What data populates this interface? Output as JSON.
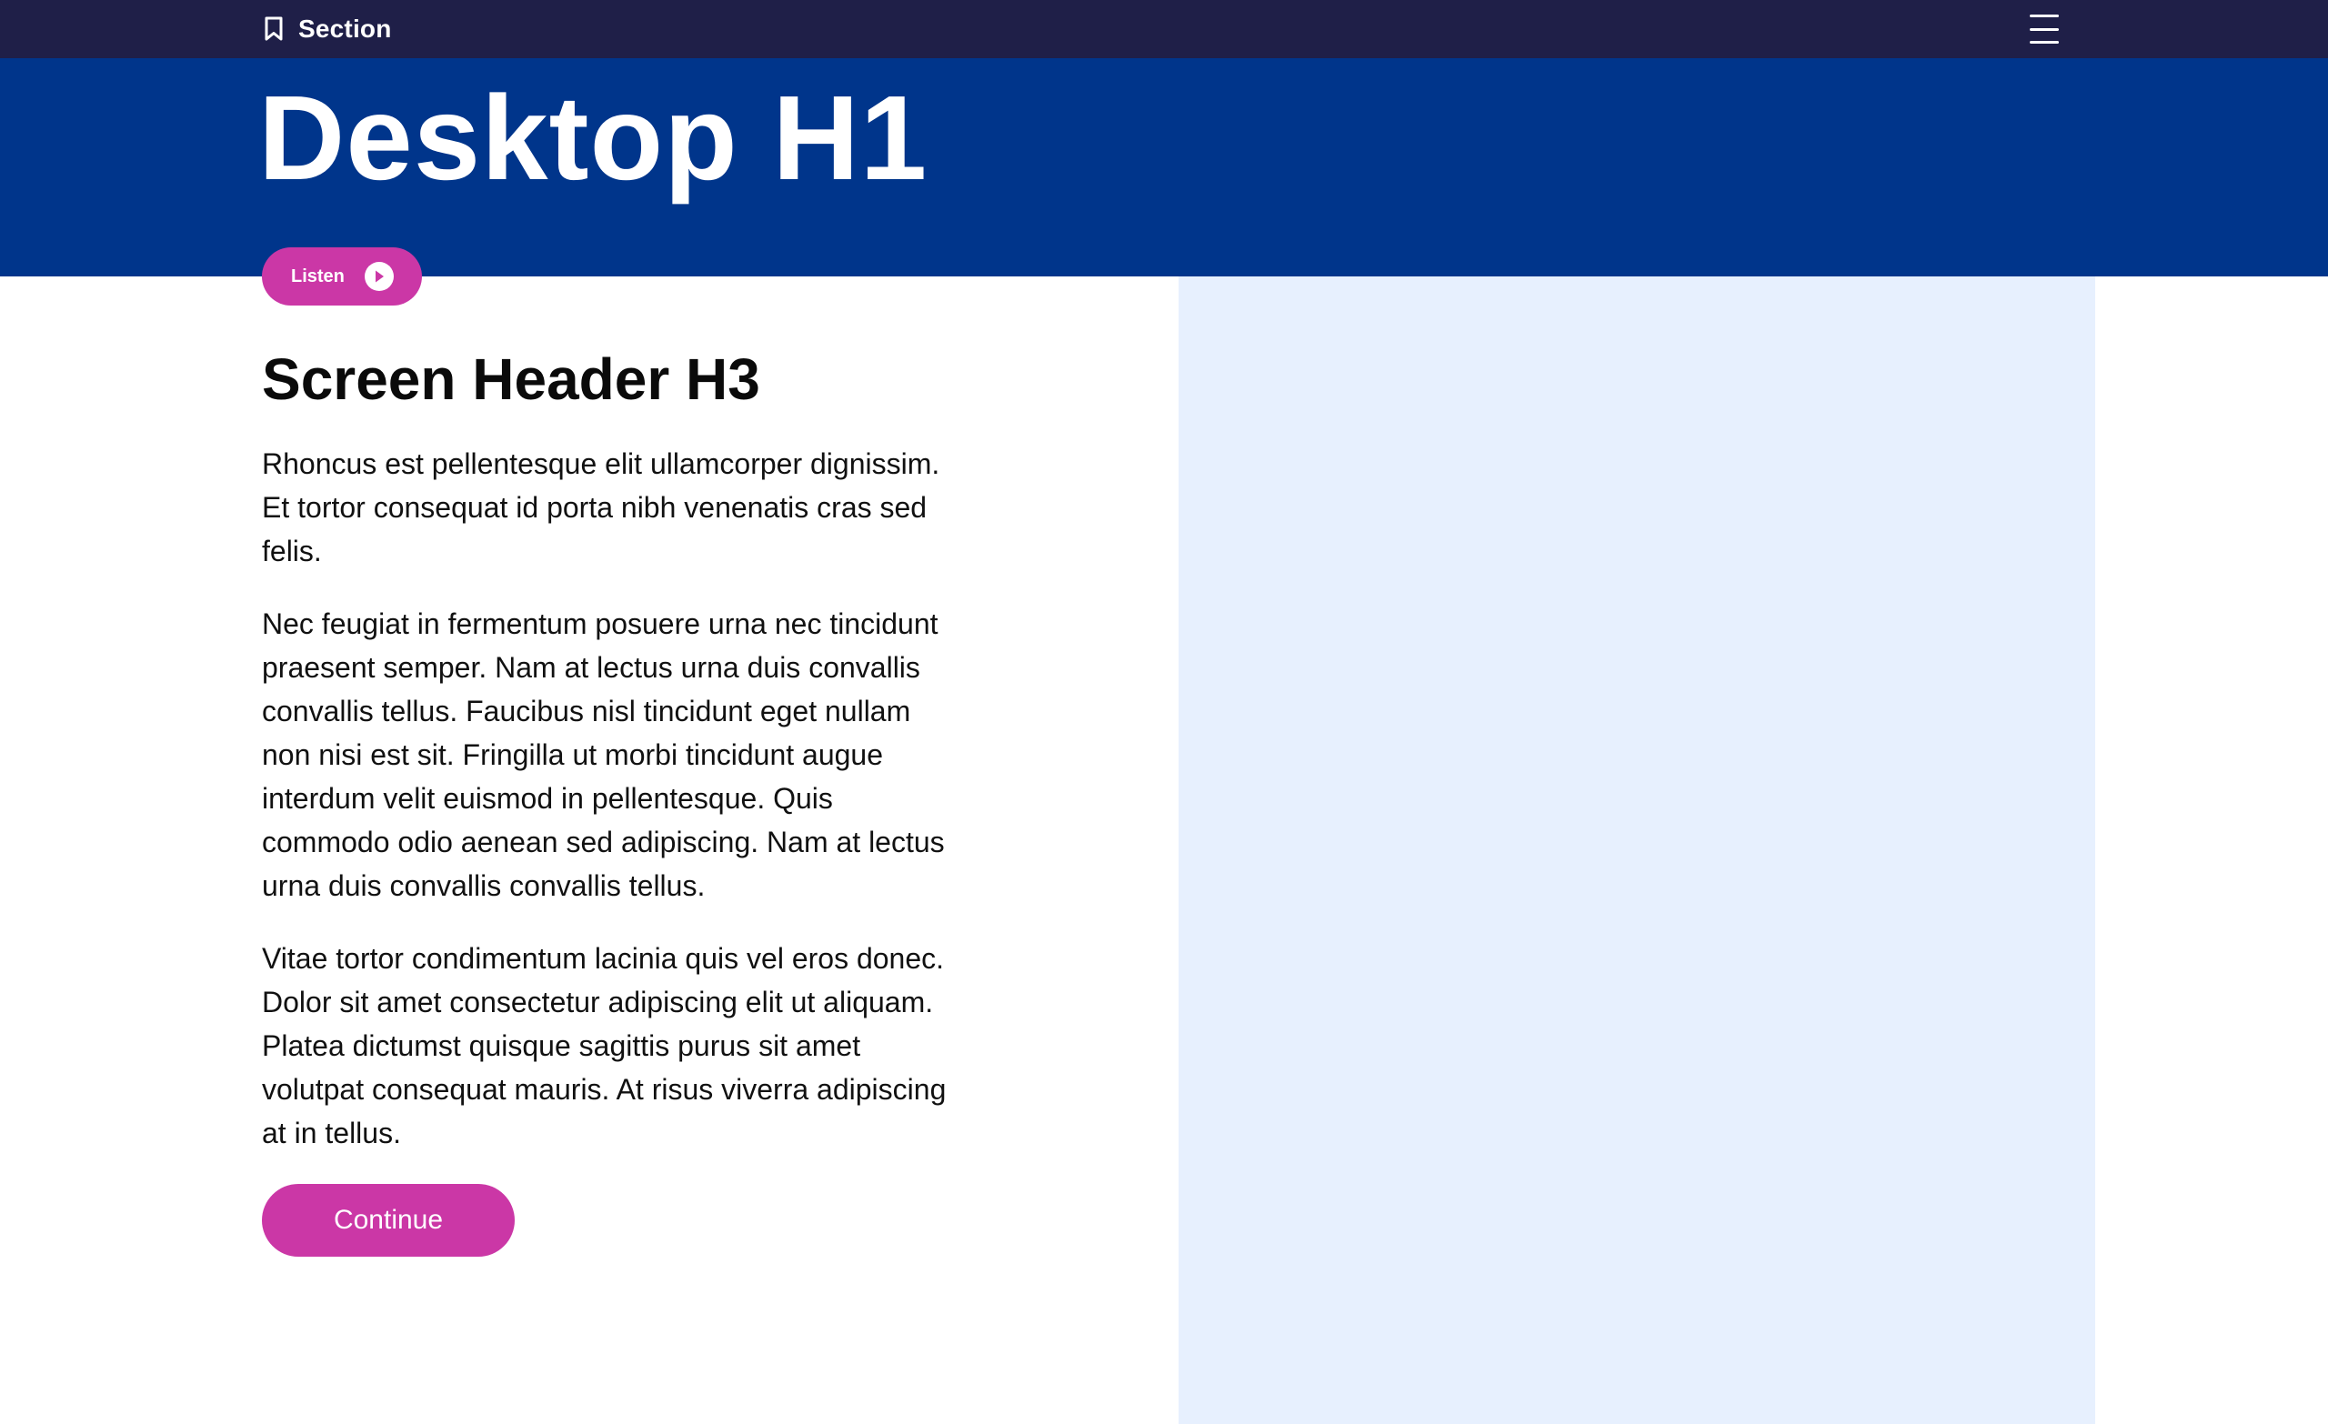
{
  "nav": {
    "section_label": "Section",
    "section_icon": "bookmark-icon",
    "menu_icon": "hamburger-menu-icon"
  },
  "hero": {
    "title": "Desktop H1"
  },
  "listen": {
    "label": "Listen",
    "icon": "play-icon"
  },
  "main": {
    "heading": "Screen Header H3",
    "paragraphs": [
      "Rhoncus est pellentesque elit ullamcorper dignissim. Et tortor consequat id porta nibh venenatis cras sed felis.",
      "Nec feugiat in fermentum posuere urna nec tincidunt praesent semper. Nam at lectus urna duis convallis convallis tellus. Faucibus nisl tincidunt eget nullam non nisi est sit. Fringilla ut morbi tincidunt augue interdum velit euismod in pellentesque. Quis commodo odio aenean sed adipiscing. Nam at lectus urna duis convallis convallis tellus.",
      "Vitae tortor condimentum lacinia quis vel eros donec. Dolor sit amet consectetur adipiscing elit ut aliquam. Platea dictumst quisque sagittis purus sit amet volutpat consequat mauris. At risus viverra adipiscing at in tellus."
    ],
    "continue_label": "Continue"
  },
  "colors": {
    "nav_bg": "#1f1f48",
    "hero_bg": "#00358b",
    "accent": "#cb37a6",
    "side_panel_bg": "#e7f0fe"
  }
}
